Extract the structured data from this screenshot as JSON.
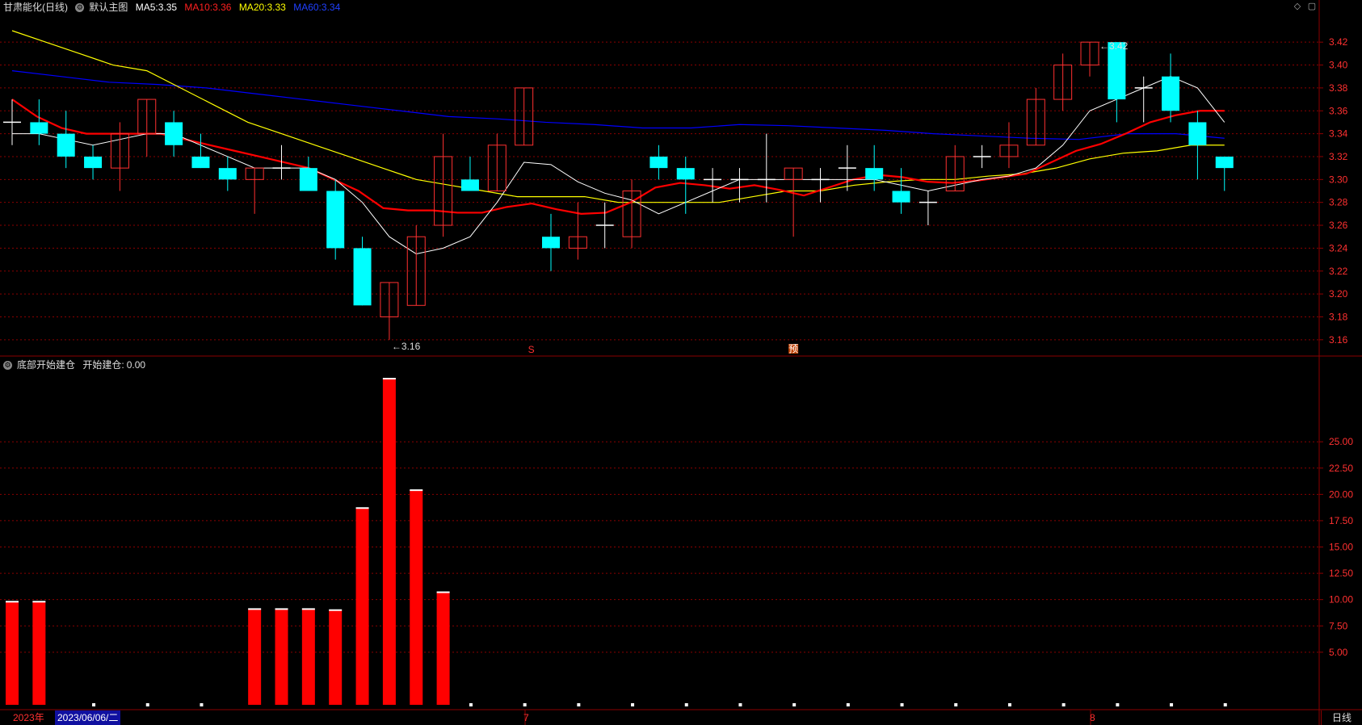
{
  "header": {
    "stock_name": "甘肃能化(日线)",
    "main_chart": "默认主图",
    "ma5_label": "MA5:",
    "ma5_value": "3.35",
    "ma10_label": "MA10:",
    "ma10_value": "3.36",
    "ma20_label": "MA20:",
    "ma20_value": "3.33",
    "ma60_label": "MA60:",
    "ma60_value": "3.34"
  },
  "sub_header": {
    "indicator": "底部开始建仓",
    "series_label": "开始建仓:",
    "series_value": "0.00"
  },
  "markers": {
    "low": "3.16",
    "high": "3.42",
    "s_mark": "S",
    "ex_mark": "预"
  },
  "timeline": {
    "year": "2023年",
    "cursor_date": "2023/06/06/二",
    "m7": "7",
    "m8": "8"
  },
  "period_button": "日线",
  "colors": {
    "up": "#ff3030",
    "down": "#00ffff",
    "doji": "#ffffff",
    "ma5": "#ffffff",
    "ma10": "#ff0000",
    "ma20": "#ffff00",
    "ma60": "#0000ff",
    "grid": "#8b0000",
    "axis_text": "#ff3030"
  },
  "chart_data": [
    {
      "type": "candlestick",
      "ylim": [
        3.15,
        3.43
      ],
      "yticks": [
        3.16,
        3.18,
        3.2,
        3.22,
        3.24,
        3.26,
        3.28,
        3.3,
        3.32,
        3.34,
        3.36,
        3.38,
        3.4,
        3.42
      ],
      "ohlc": [
        [
          3.35,
          3.37,
          3.33,
          3.35
        ],
        [
          3.35,
          3.37,
          3.33,
          3.34
        ],
        [
          3.34,
          3.36,
          3.31,
          3.32
        ],
        [
          3.32,
          3.33,
          3.3,
          3.31
        ],
        [
          3.31,
          3.35,
          3.29,
          3.34
        ],
        [
          3.34,
          3.37,
          3.32,
          3.37
        ],
        [
          3.35,
          3.36,
          3.32,
          3.33
        ],
        [
          3.32,
          3.34,
          3.31,
          3.31
        ],
        [
          3.31,
          3.32,
          3.29,
          3.3
        ],
        [
          3.3,
          3.31,
          3.27,
          3.31
        ],
        [
          3.31,
          3.33,
          3.3,
          3.31
        ],
        [
          3.31,
          3.32,
          3.29,
          3.29
        ],
        [
          3.29,
          3.3,
          3.23,
          3.24
        ],
        [
          3.24,
          3.25,
          3.19,
          3.19
        ],
        [
          3.18,
          3.21,
          3.16,
          3.21
        ],
        [
          3.19,
          3.26,
          3.19,
          3.25
        ],
        [
          3.26,
          3.34,
          3.25,
          3.32
        ],
        [
          3.3,
          3.32,
          3.29,
          3.29
        ],
        [
          3.29,
          3.34,
          3.29,
          3.33
        ],
        [
          3.33,
          3.38,
          3.33,
          3.38
        ],
        [
          3.25,
          3.27,
          3.22,
          3.24
        ],
        [
          3.24,
          3.28,
          3.23,
          3.25
        ],
        [
          3.26,
          3.28,
          3.24,
          3.26
        ],
        [
          3.25,
          3.3,
          3.24,
          3.29
        ],
        [
          3.32,
          3.33,
          3.3,
          3.31
        ],
        [
          3.31,
          3.32,
          3.27,
          3.3
        ],
        [
          3.3,
          3.31,
          3.28,
          3.3
        ],
        [
          3.3,
          3.31,
          3.28,
          3.3
        ],
        [
          3.3,
          3.34,
          3.28,
          3.3
        ],
        [
          3.3,
          3.31,
          3.25,
          3.31
        ],
        [
          3.3,
          3.31,
          3.28,
          3.3
        ],
        [
          3.31,
          3.33,
          3.29,
          3.31
        ],
        [
          3.31,
          3.33,
          3.29,
          3.3
        ],
        [
          3.29,
          3.31,
          3.27,
          3.28
        ],
        [
          3.28,
          3.29,
          3.26,
          3.28
        ],
        [
          3.29,
          3.33,
          3.29,
          3.32
        ],
        [
          3.32,
          3.33,
          3.31,
          3.32
        ],
        [
          3.32,
          3.35,
          3.31,
          3.33
        ],
        [
          3.33,
          3.38,
          3.33,
          3.37
        ],
        [
          3.37,
          3.41,
          3.36,
          3.4
        ],
        [
          3.4,
          3.42,
          3.39,
          3.42
        ],
        [
          3.42,
          3.42,
          3.35,
          3.37
        ],
        [
          3.38,
          3.39,
          3.35,
          3.38
        ],
        [
          3.39,
          3.41,
          3.35,
          3.36
        ],
        [
          3.35,
          3.36,
          3.3,
          3.33
        ],
        [
          3.32,
          3.32,
          3.29,
          3.31
        ]
      ],
      "ma5": [
        3.34,
        3.34,
        3.335,
        3.33,
        3.335,
        3.34,
        3.34,
        3.33,
        3.32,
        3.31,
        3.31,
        3.31,
        3.3,
        3.28,
        3.25,
        3.235,
        3.24,
        3.25,
        3.28,
        3.315,
        3.313,
        3.298,
        3.288,
        3.282,
        3.27,
        3.28,
        3.29,
        3.3,
        3.3,
        3.3,
        3.3,
        3.3,
        3.3,
        3.295,
        3.29,
        3.295,
        3.3,
        3.303,
        3.31,
        3.33,
        3.36,
        3.37,
        3.38,
        3.39,
        3.38,
        3.35
      ],
      "ma10": [
        3.37,
        3.355,
        3.345,
        3.34,
        3.34,
        3.34,
        3.34,
        3.335,
        3.33,
        3.325,
        3.32,
        3.315,
        3.31,
        3.3,
        3.29,
        3.275,
        3.273,
        3.273,
        3.271,
        3.271,
        3.276,
        3.279,
        3.274,
        3.27,
        3.271,
        3.28,
        3.293,
        3.297,
        3.295,
        3.292,
        3.295,
        3.291,
        3.286,
        3.293,
        3.3,
        3.304,
        3.302,
        3.298,
        3.297,
        3.299,
        3.302,
        3.305,
        3.315,
        3.325,
        3.331,
        3.34,
        3.35,
        3.356,
        3.36,
        3.36
      ],
      "ma20": [
        3.43,
        3.42,
        3.41,
        3.4,
        3.395,
        3.38,
        3.365,
        3.35,
        3.34,
        3.33,
        3.32,
        3.31,
        3.3,
        3.295,
        3.29,
        3.285,
        3.285,
        3.285,
        3.28,
        3.28,
        3.28,
        3.28,
        3.285,
        3.29,
        3.29,
        3.295,
        3.298,
        3.3,
        3.3,
        3.303,
        3.305,
        3.31,
        3.318,
        3.323,
        3.325,
        3.33,
        3.33
      ],
      "ma60": [
        3.395,
        3.39,
        3.385,
        3.383,
        3.38,
        3.375,
        3.37,
        3.365,
        3.36,
        3.355,
        3.353,
        3.35,
        3.348,
        3.345,
        3.345,
        3.348,
        3.347,
        3.345,
        3.343,
        3.34,
        3.338,
        3.336,
        3.335,
        3.34,
        3.34,
        3.336
      ]
    },
    {
      "type": "bar",
      "series_name": "开始建仓",
      "ylim": [
        0,
        31
      ],
      "yticks": [
        5.0,
        7.5,
        10.0,
        12.5,
        15.0,
        17.5,
        20.0,
        22.5,
        25.0
      ],
      "values": [
        9.8,
        9.8,
        0,
        0,
        0,
        0,
        0,
        0,
        0,
        9.1,
        9.1,
        9.1,
        9.0,
        18.7,
        31.0,
        20.4,
        10.7,
        0,
        0,
        0,
        0,
        0,
        0,
        0,
        0,
        0,
        0,
        0,
        0,
        0,
        0,
        0,
        0,
        0,
        0,
        0,
        0,
        0,
        0,
        0,
        0,
        0,
        0,
        0,
        0,
        0
      ],
      "zero_marks_at": [
        3,
        5,
        7,
        17,
        19,
        21,
        23,
        25,
        27,
        29,
        31,
        33,
        35,
        37,
        39,
        41,
        43,
        45
      ]
    }
  ]
}
